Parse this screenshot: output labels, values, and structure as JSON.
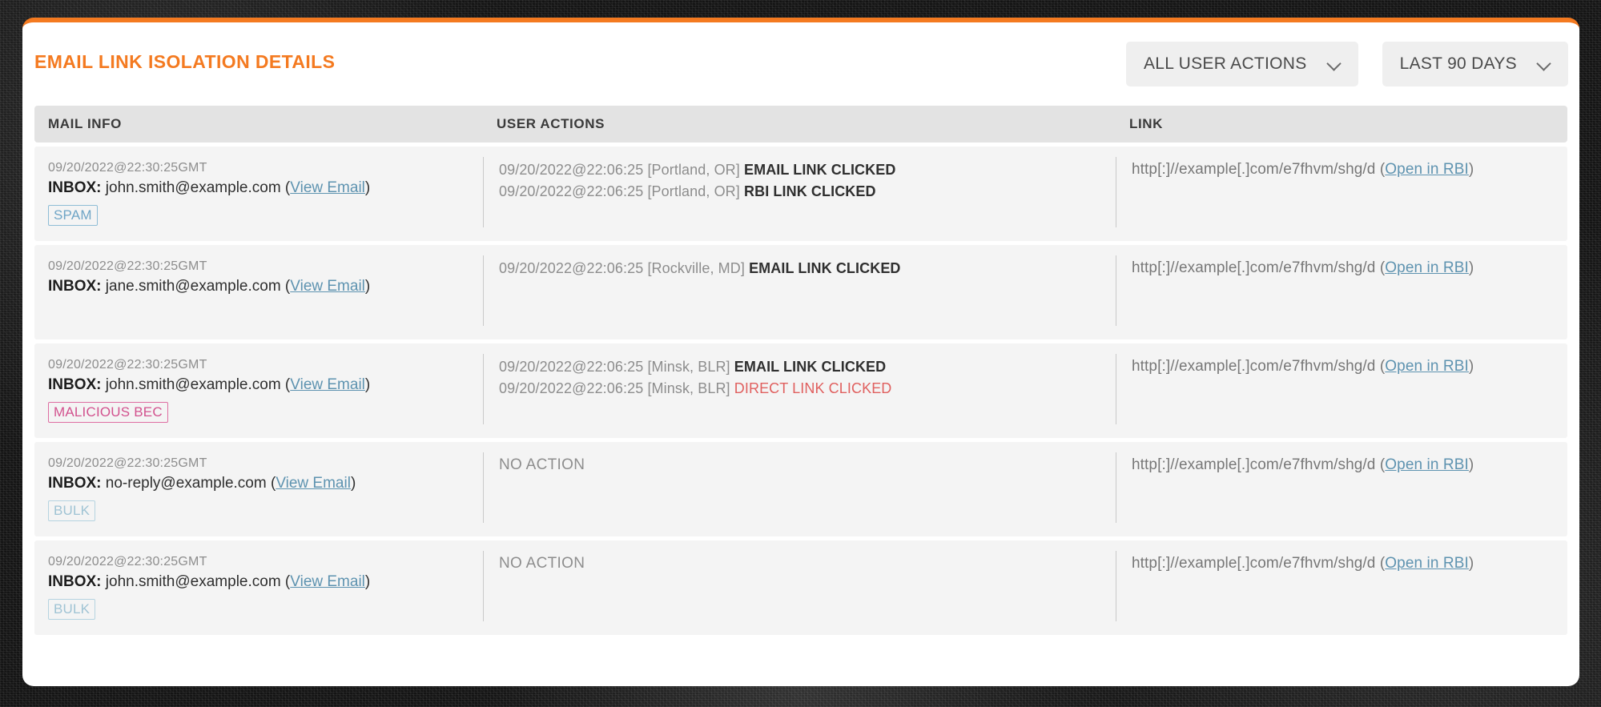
{
  "panel": {
    "title": "EMAIL LINK ISOLATION DETAILS",
    "accent_color": "#F47A20"
  },
  "filters": [
    {
      "name": "user-actions-filter",
      "label": "ALL USER ACTIONS",
      "icon": "chevron-down-icon"
    },
    {
      "name": "time-range-filter",
      "label": "LAST 90 DAYS",
      "icon": "chevron-down-icon"
    }
  ],
  "table": {
    "columns": [
      "MAIL INFO",
      "USER ACTIONS",
      "LINK"
    ],
    "rows": [
      {
        "mail": {
          "timestamp": "09/20/2022@22:30:25GMT",
          "folder_label": "INBOX:",
          "address": "john.smith@example.com",
          "view_email_link": "View Email",
          "badge": {
            "text": "SPAM",
            "style": "spam",
            "color": "#6fa5c6"
          }
        },
        "actions": [
          {
            "timestamp": "09/20/2022@22:06:25",
            "location": "[Portland, OR]",
            "verdict": "EMAIL LINK CLICKED",
            "severity": "normal"
          },
          {
            "timestamp": "09/20/2022@22:06:25",
            "location": "[Portland, OR]",
            "verdict": "RBI LINK CLICKED",
            "severity": "normal"
          }
        ],
        "link": {
          "url": "http[:]//example[.]com/e7fhvm/shg/d",
          "open_label": "Open in RBI"
        }
      },
      {
        "mail": {
          "timestamp": "09/20/2022@22:30:25GMT",
          "folder_label": "INBOX:",
          "address": "jane.smith@example.com",
          "view_email_link": "View Email",
          "badge": null
        },
        "actions": [
          {
            "timestamp": "09/20/2022@22:06:25",
            "location": "[Rockville, MD]",
            "verdict": "EMAIL LINK CLICKED",
            "severity": "normal"
          }
        ],
        "link": {
          "url": "http[:]//example[.]com/e7fhvm/shg/d",
          "open_label": "Open in RBI"
        }
      },
      {
        "mail": {
          "timestamp": "09/20/2022@22:30:25GMT",
          "folder_label": "INBOX:",
          "address": "john.smith@example.com",
          "view_email_link": "View Email",
          "badge": {
            "text": "MALICIOUS BEC",
            "style": "malicious",
            "color": "#d2528e"
          }
        },
        "actions": [
          {
            "timestamp": "09/20/2022@22:06:25",
            "location": "[Minsk, BLR]",
            "verdict": "EMAIL LINK CLICKED",
            "severity": "normal"
          },
          {
            "timestamp": "09/20/2022@22:06:25",
            "location": "[Minsk, BLR]",
            "verdict": "DIRECT LINK CLICKED",
            "severity": "danger"
          }
        ],
        "link": {
          "url": "http[:]//example[.]com/e7fhvm/shg/d",
          "open_label": "Open in RBI"
        }
      },
      {
        "mail": {
          "timestamp": "09/20/2022@22:30:25GMT",
          "folder_label": "INBOX:",
          "address": "no-reply@example.com",
          "view_email_link": "View Email",
          "badge": {
            "text": "BULK",
            "style": "bulk",
            "color": "#9fc3d4"
          }
        },
        "actions": [],
        "no_action_text": "NO ACTION",
        "link": {
          "url": "http[:]//example[.]com/e7fhvm/shg/d",
          "open_label": "Open in RBI"
        }
      },
      {
        "mail": {
          "timestamp": "09/20/2022@22:30:25GMT",
          "folder_label": "INBOX:",
          "address": "john.smith@example.com",
          "view_email_link": "View Email",
          "badge": {
            "text": "BULK",
            "style": "bulk",
            "color": "#9fc3d4"
          }
        },
        "actions": [],
        "no_action_text": "NO ACTION",
        "link": {
          "url": "http[:]//example[.]com/e7fhvm/shg/d",
          "open_label": "Open in RBI"
        }
      }
    ]
  }
}
